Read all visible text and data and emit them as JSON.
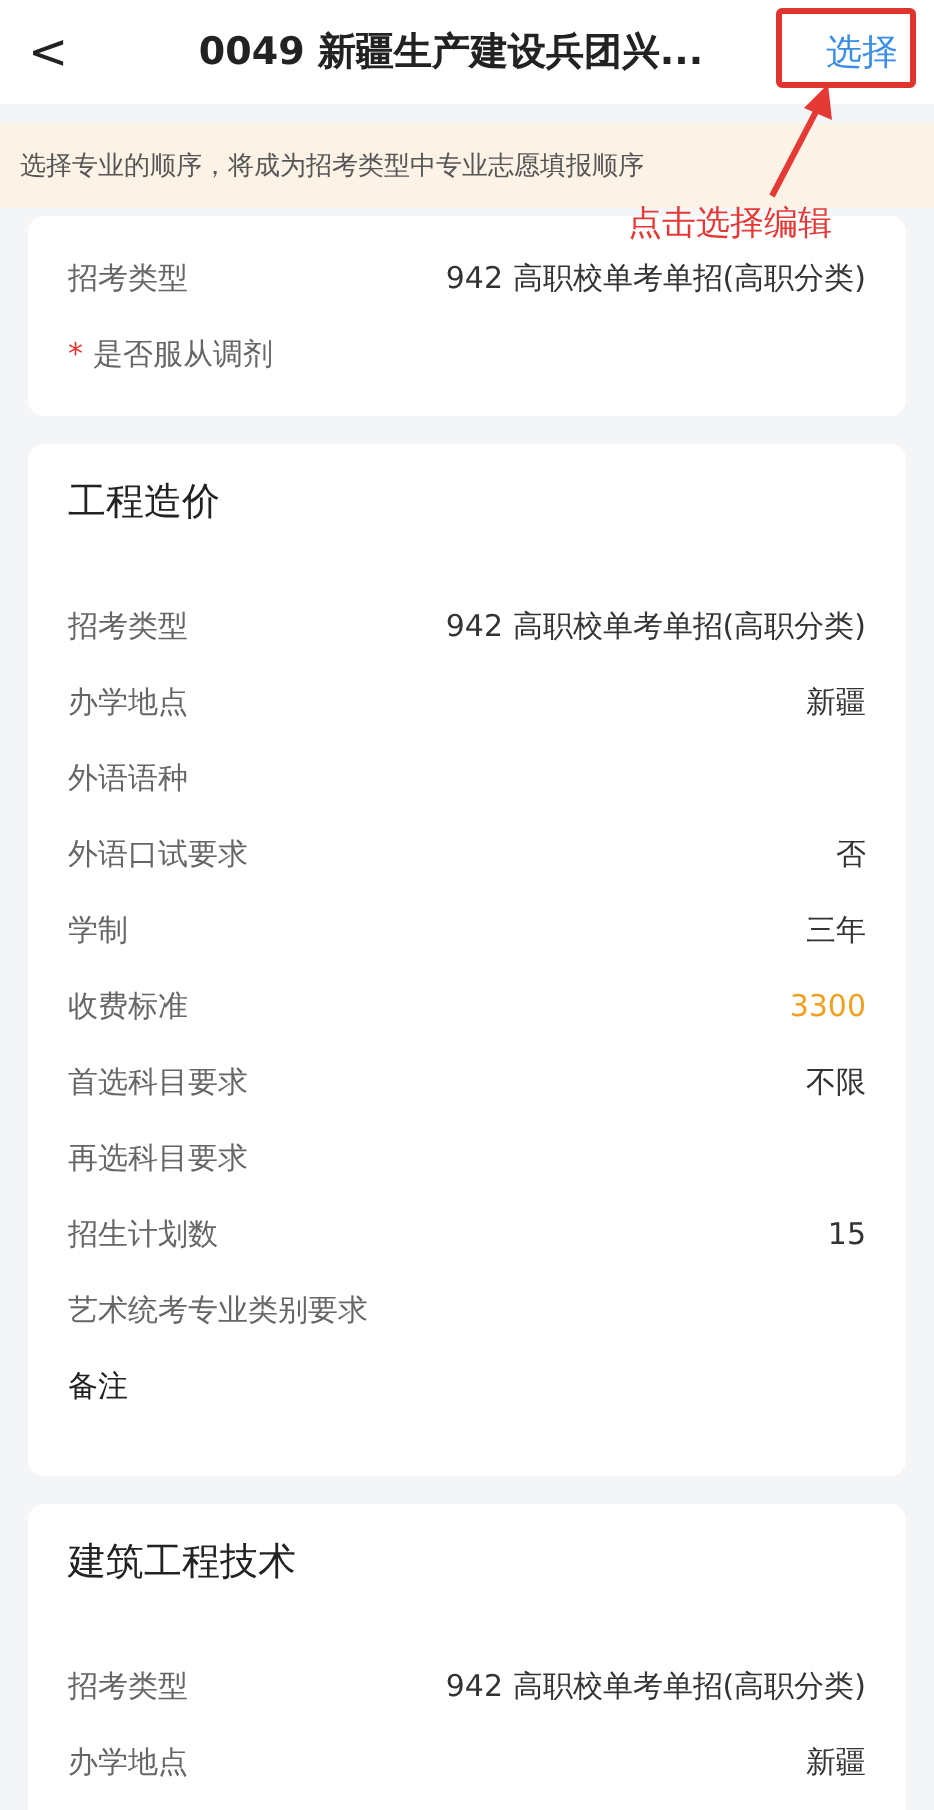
{
  "header": {
    "back": "<",
    "title": "0049 新疆生产建设兵团兴...",
    "action": "选择"
  },
  "annotation": {
    "text": "点击选择编辑"
  },
  "notice": "选择专业的顺序，将成为招考类型中专业志愿填报顺序",
  "summary": {
    "rows": [
      {
        "label": "招考类型",
        "value": "942 高职校单考单招(高职分类)"
      }
    ],
    "required_label": {
      "mark": "*",
      "text": "是否服从调剂"
    }
  },
  "majors": [
    {
      "name": "工程造价",
      "rows": [
        {
          "label": "招考类型",
          "value": "942 高职校单考单招(高职分类)",
          "kind": "plain"
        },
        {
          "label": "办学地点",
          "value": "新疆",
          "kind": "plain"
        },
        {
          "label": "外语语种",
          "kind": "plain"
        },
        {
          "label": "外语口试要求",
          "value": "否",
          "kind": "plain"
        },
        {
          "label": "学制",
          "value": "三年",
          "kind": "plain"
        },
        {
          "label": "收费标准",
          "value": "3300",
          "kind": "fee"
        },
        {
          "label": "首选科目要求",
          "value": "不限",
          "kind": "plain"
        },
        {
          "label": "再选科目要求",
          "kind": "plain"
        },
        {
          "label": "招生计划数",
          "value": "15",
          "kind": "plain"
        },
        {
          "label": "艺术统考专业类别要求",
          "kind": "plain"
        },
        {
          "label": "备注",
          "kind": "note"
        }
      ]
    },
    {
      "name": "建筑工程技术",
      "rows": [
        {
          "label": "招考类型",
          "value": "942 高职校单考单招(高职分类)",
          "kind": "plain"
        },
        {
          "label": "办学地点",
          "value": "新疆",
          "kind": "plain"
        }
      ]
    }
  ]
}
